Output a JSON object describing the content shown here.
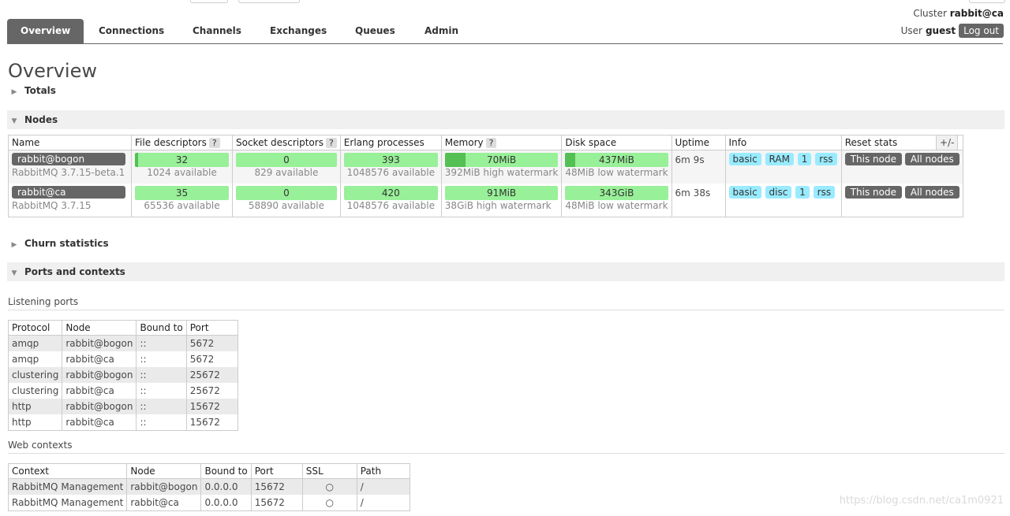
{
  "header": {
    "cluster_label": "Cluster",
    "cluster_name": "rabbit@ca",
    "user_label": "User",
    "user_name": "guest",
    "logout": "Log out"
  },
  "tabs": [
    {
      "label": "Overview",
      "active": true
    },
    {
      "label": "Connections"
    },
    {
      "label": "Channels"
    },
    {
      "label": "Exchanges"
    },
    {
      "label": "Queues"
    },
    {
      "label": "Admin"
    }
  ],
  "page_title": "Overview",
  "sections": {
    "totals": "Totals",
    "nodes": "Nodes",
    "churn": "Churn statistics",
    "ports": "Ports and contexts"
  },
  "nodes_table": {
    "headers": [
      "Name",
      "File descriptors",
      "Socket descriptors",
      "Erlang processes",
      "Memory",
      "Disk space",
      "Uptime",
      "Info",
      "Reset stats"
    ],
    "help": "?",
    "plus_minus": "+/-",
    "rows": [
      {
        "name": "rabbit@bogon",
        "version": "RabbitMQ 3.7.15-beta.1",
        "fd": "32",
        "fd_avail": "1024 available",
        "fd_fill": 0.03,
        "sockets": "0",
        "sockets_avail": "829 available",
        "procs": "393",
        "procs_avail": "1048576 available",
        "memory": "70MiB",
        "memory_sub": "392MiB high watermark",
        "memory_fill": 0.18,
        "disk": "437MiB",
        "disk_sub": "48MiB low watermark",
        "disk_fill": 0.1,
        "uptime": "6m 9s",
        "info": [
          "basic",
          "RAM",
          "1",
          "rss"
        ],
        "reset": [
          "This node",
          "All nodes"
        ]
      },
      {
        "name": "rabbit@ca",
        "version": "RabbitMQ 3.7.15",
        "fd": "35",
        "fd_avail": "65536 available",
        "fd_fill": 0.0,
        "sockets": "0",
        "sockets_avail": "58890 available",
        "procs": "420",
        "procs_avail": "1048576 available",
        "memory": "91MiB",
        "memory_sub": "38GiB high watermark",
        "memory_fill": 0.0,
        "disk": "343GiB",
        "disk_sub": "48MiB low watermark",
        "disk_fill": 0.0,
        "uptime": "6m 38s",
        "info": [
          "basic",
          "disc",
          "1",
          "rss"
        ],
        "reset": [
          "This node",
          "All nodes"
        ]
      }
    ]
  },
  "listening_ports": {
    "title": "Listening ports",
    "headers": [
      "Protocol",
      "Node",
      "Bound to",
      "Port"
    ],
    "rows": [
      [
        "amqp",
        "rabbit@bogon",
        "::",
        "5672"
      ],
      [
        "amqp",
        "rabbit@ca",
        "::",
        "5672"
      ],
      [
        "clustering",
        "rabbit@bogon",
        "::",
        "25672"
      ],
      [
        "clustering",
        "rabbit@ca",
        "::",
        "25672"
      ],
      [
        "http",
        "rabbit@bogon",
        "::",
        "15672"
      ],
      [
        "http",
        "rabbit@ca",
        "::",
        "15672"
      ]
    ]
  },
  "web_contexts": {
    "title": "Web contexts",
    "headers": [
      "Context",
      "Node",
      "Bound to",
      "Port",
      "SSL",
      "Path"
    ],
    "rows": [
      [
        "RabbitMQ Management",
        "rabbit@bogon",
        "0.0.0.0",
        "15672",
        "○",
        "/"
      ],
      [
        "RabbitMQ Management",
        "rabbit@ca",
        "0.0.0.0",
        "15672",
        "○",
        "/"
      ]
    ]
  },
  "watermark": "https://blog.csdn.net/ca1m0921"
}
